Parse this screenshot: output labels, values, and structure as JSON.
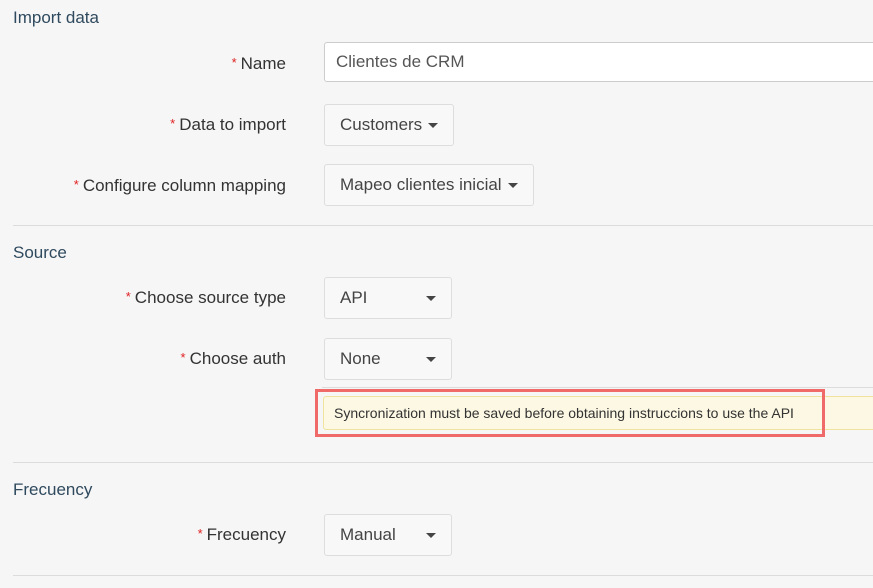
{
  "sections": {
    "import_data": {
      "title": "Import data",
      "fields": {
        "name": {
          "label": "Name",
          "value": "Clientes de CRM"
        },
        "data_to_import": {
          "label": "Data to import",
          "value": "Customers"
        },
        "column_mapping": {
          "label": "Configure column mapping",
          "value": "Mapeo clientes inicial"
        }
      }
    },
    "source": {
      "title": "Source",
      "fields": {
        "source_type": {
          "label": "Choose source type",
          "value": "API"
        },
        "auth": {
          "label": "Choose auth",
          "value": "None"
        }
      },
      "alert": "Syncronization must be saved before obtaining instruccions to use the API"
    },
    "frequency": {
      "title": "Frecuency",
      "fields": {
        "frequency": {
          "label": "Frecuency",
          "value": "Manual"
        }
      }
    }
  },
  "required_marker": "*",
  "colors": {
    "section_title": "#2f4a5e",
    "required": "#e02020",
    "alert_bg": "#fcf8e3",
    "highlight": "#f06a6a"
  }
}
